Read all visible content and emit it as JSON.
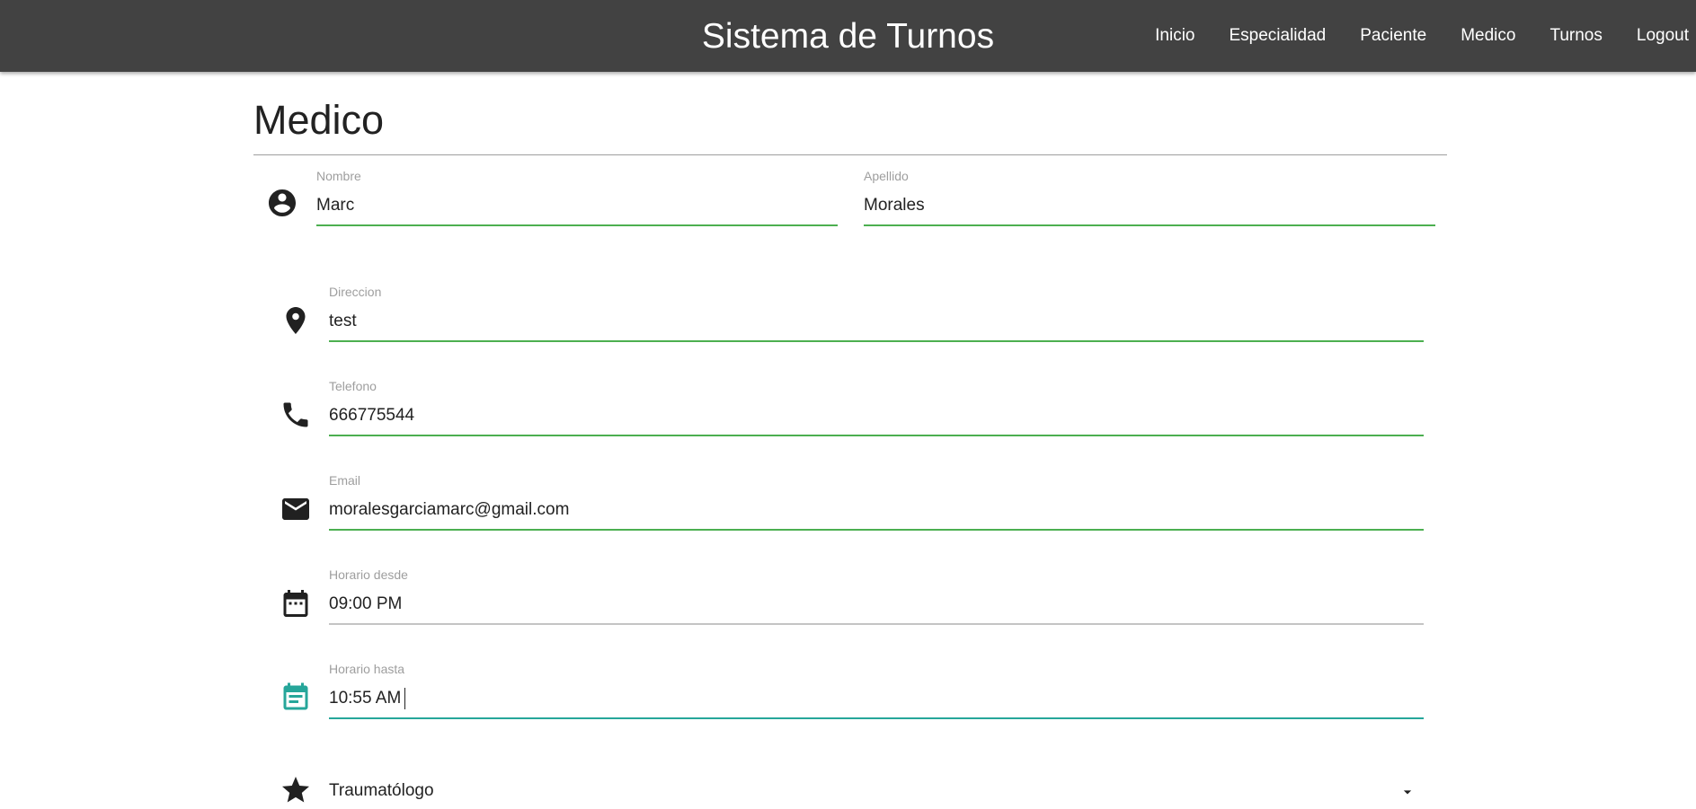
{
  "app": {
    "title": "Sistema de Turnos"
  },
  "nav": {
    "items": [
      {
        "label": "Inicio"
      },
      {
        "label": "Especialidad"
      },
      {
        "label": "Paciente"
      },
      {
        "label": "Medico"
      },
      {
        "label": "Turnos"
      },
      {
        "label": "Logout"
      }
    ]
  },
  "page": {
    "title": "Medico"
  },
  "form": {
    "nombre": {
      "label": "Nombre",
      "value": "Marc",
      "icon": "account-circle-icon"
    },
    "apellido": {
      "label": "Apellido",
      "value": "Morales"
    },
    "direccion": {
      "label": "Direccion",
      "value": "test",
      "icon": "location-pin-icon"
    },
    "telefono": {
      "label": "Telefono",
      "value": "666775544",
      "icon": "phone-icon"
    },
    "email": {
      "label": "Email",
      "value": "moralesgarciamarc@gmail.com",
      "icon": "email-icon"
    },
    "horario_desde": {
      "label": "Horario desde",
      "value": "09:00 PM",
      "icon": "calendar-icon"
    },
    "horario_hasta": {
      "label": "Horario hasta",
      "value": "10:55 AM",
      "icon": "event-note-icon"
    },
    "especialidad": {
      "value": "Traumatólogo",
      "icon": "star-icon"
    }
  },
  "colors": {
    "navbar": "#424242",
    "valid_underline": "#4caf50",
    "active_underline": "#26a69a",
    "inactive_underline": "#c4c4c4",
    "label": "#9e9e9e"
  }
}
